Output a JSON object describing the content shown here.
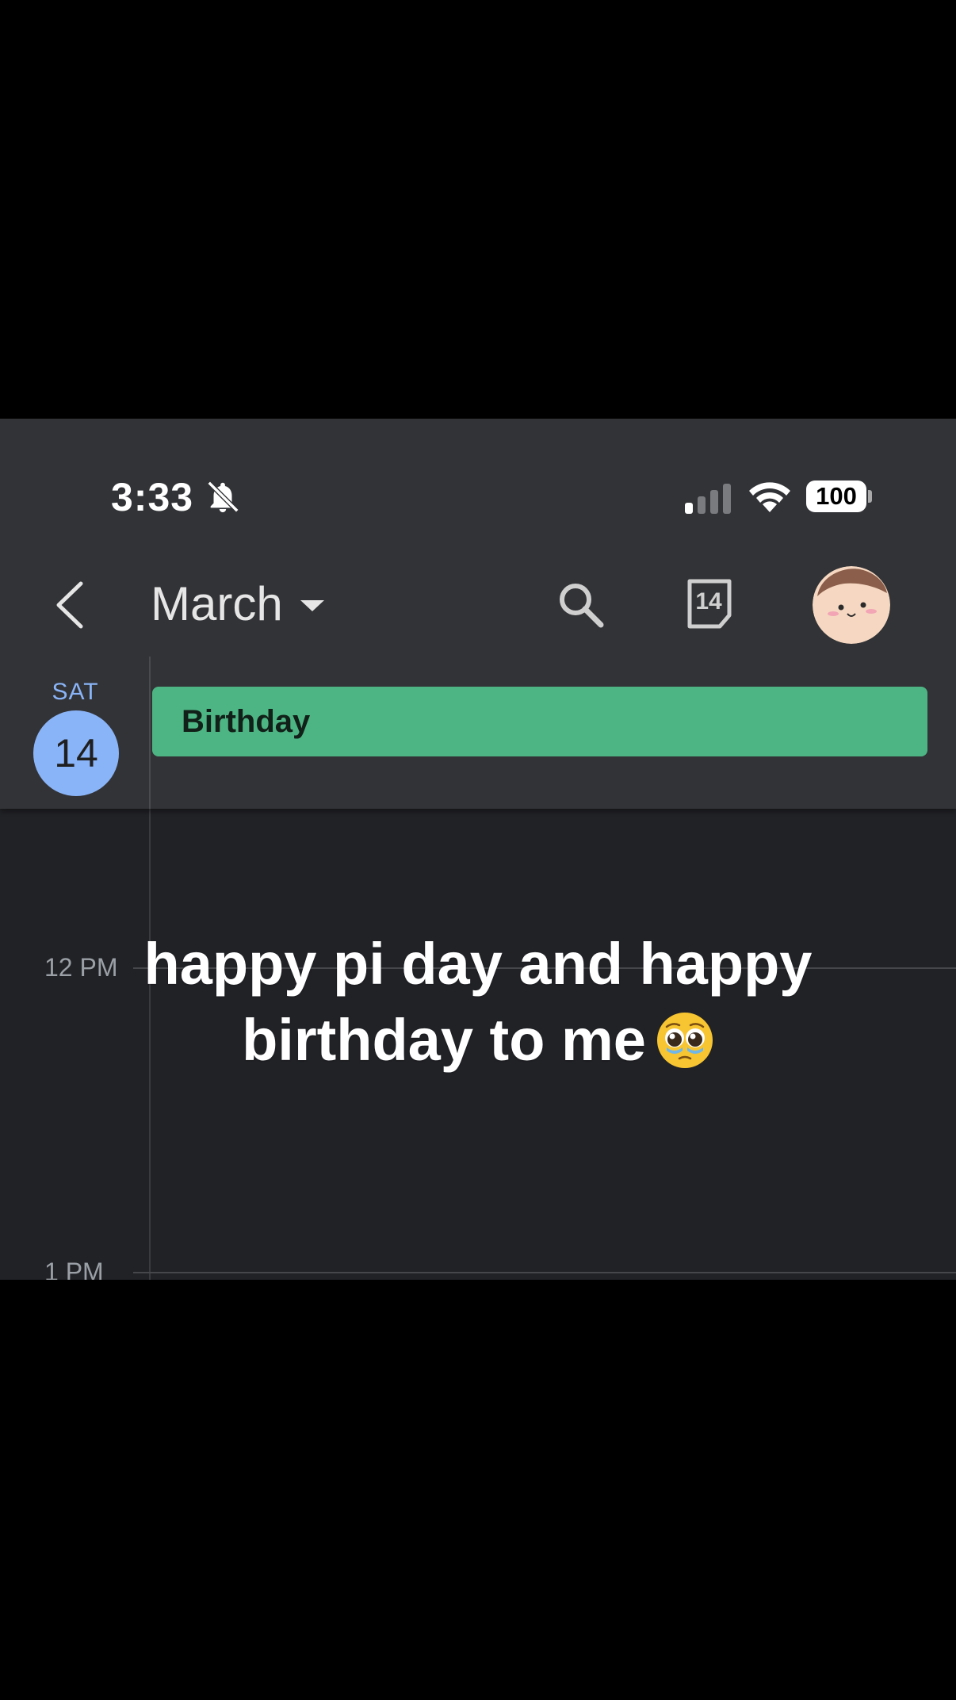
{
  "status_bar": {
    "time": "3:33",
    "battery": "100"
  },
  "app_bar": {
    "month": "March",
    "today_day": "14"
  },
  "day_header": {
    "day_name": "SAT",
    "day_number": "14"
  },
  "all_day_event": {
    "title": "Birthday",
    "color": "#4db584"
  },
  "grid": {
    "hours": [
      "12 PM",
      "1 PM"
    ]
  },
  "caption": {
    "line1": "happy pi day and happy",
    "line2": "birthday to me",
    "emoji": "pleading-face-emoji"
  },
  "colors": {
    "accent": "#8ab4f8",
    "background": "#212226",
    "header": "#323336"
  }
}
